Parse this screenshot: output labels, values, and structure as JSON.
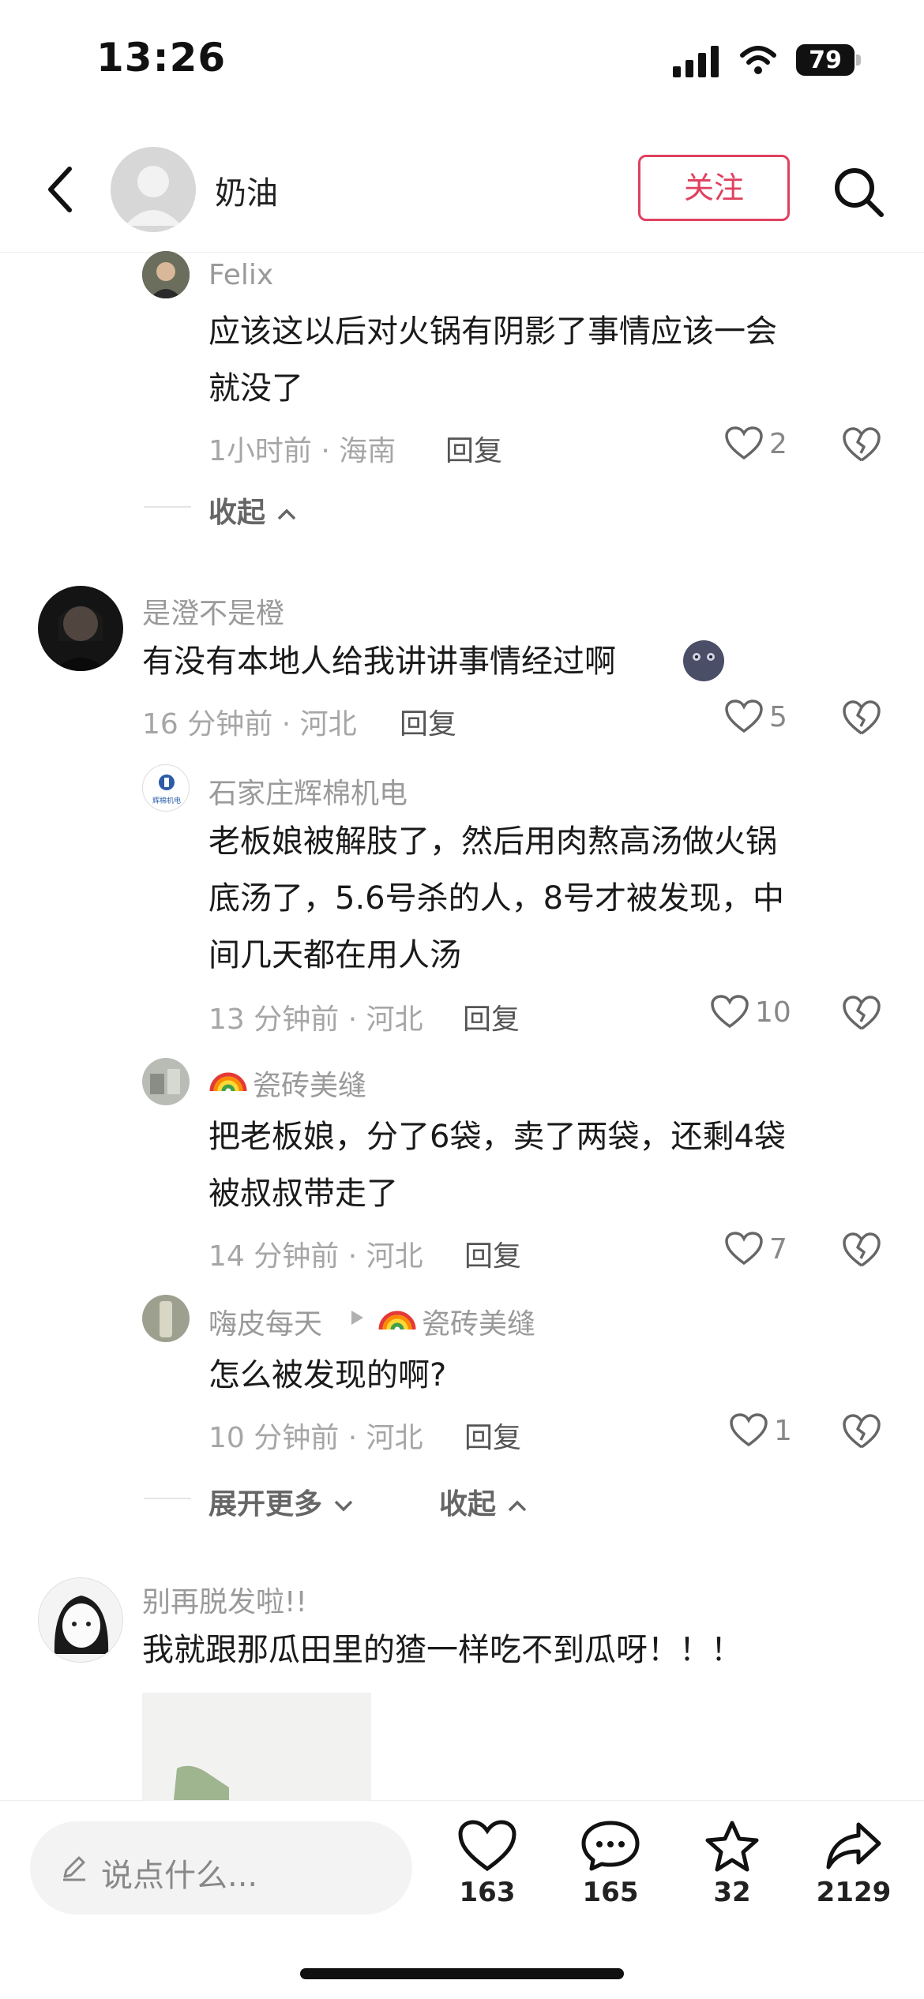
{
  "status_bar": {
    "time": "13:26",
    "battery": "79"
  },
  "header": {
    "title": "奶油",
    "follow_label": "关注"
  },
  "icons": [
    "back-icon",
    "search-icon",
    "heart-icon",
    "dislike-icon",
    "chevron-up-icon",
    "chevron-down-icon",
    "pen-icon",
    "comment-icon",
    "star-icon",
    "share-icon"
  ],
  "comments": [
    {
      "user": "Felix",
      "text_lines": [
        "应该这以后对火锅有阴影了事情应该一会",
        "就没了"
      ],
      "meta": "1小时前 · 海南",
      "reply": "回复",
      "likes": "2"
    },
    {
      "user": "是澄不是橙",
      "text": "有没有本地人给我讲讲事情经过啊",
      "meta": "16 分钟前 · 河北",
      "reply": "回复",
      "likes": "5"
    },
    {
      "user": "石家庄辉棉机电",
      "avatar_text": "辉棉机电",
      "text_lines": [
        "老板娘被解肢了，然后用肉熬高汤做火锅",
        "底汤了，5.6号杀的人，8号才被发现，中",
        "间几天都在用人汤"
      ],
      "meta": "13 分钟前 · 河北",
      "reply": "回复",
      "likes": "10"
    },
    {
      "user": "瓷砖美缝",
      "text_lines": [
        "把老板娘，分了6袋，卖了两袋，还剩4袋",
        "被叔叔带走了"
      ],
      "meta": "14 分钟前 · 河北",
      "reply": "回复",
      "likes": "7"
    },
    {
      "user": "嗨皮每天",
      "reply_to": "瓷砖美缝",
      "text": "怎么被发现的啊?",
      "meta": "10 分钟前 · 河北",
      "reply": "回复",
      "likes": "1"
    },
    {
      "user": "别再脱发啦!!",
      "text": "我就跟那瓜田里的猹一样吃不到瓜呀！！！"
    }
  ],
  "fold": {
    "collapse_label": "收起",
    "expand_more_label": "展开更多"
  },
  "bottom_bar": {
    "input_placeholder": "说点什么...",
    "like_count": "163",
    "comment_count": "165",
    "star_count": "32",
    "share_count": "2129"
  },
  "colors": {
    "accent": "#e0405f",
    "meta_gray": "#a6a6a6"
  }
}
